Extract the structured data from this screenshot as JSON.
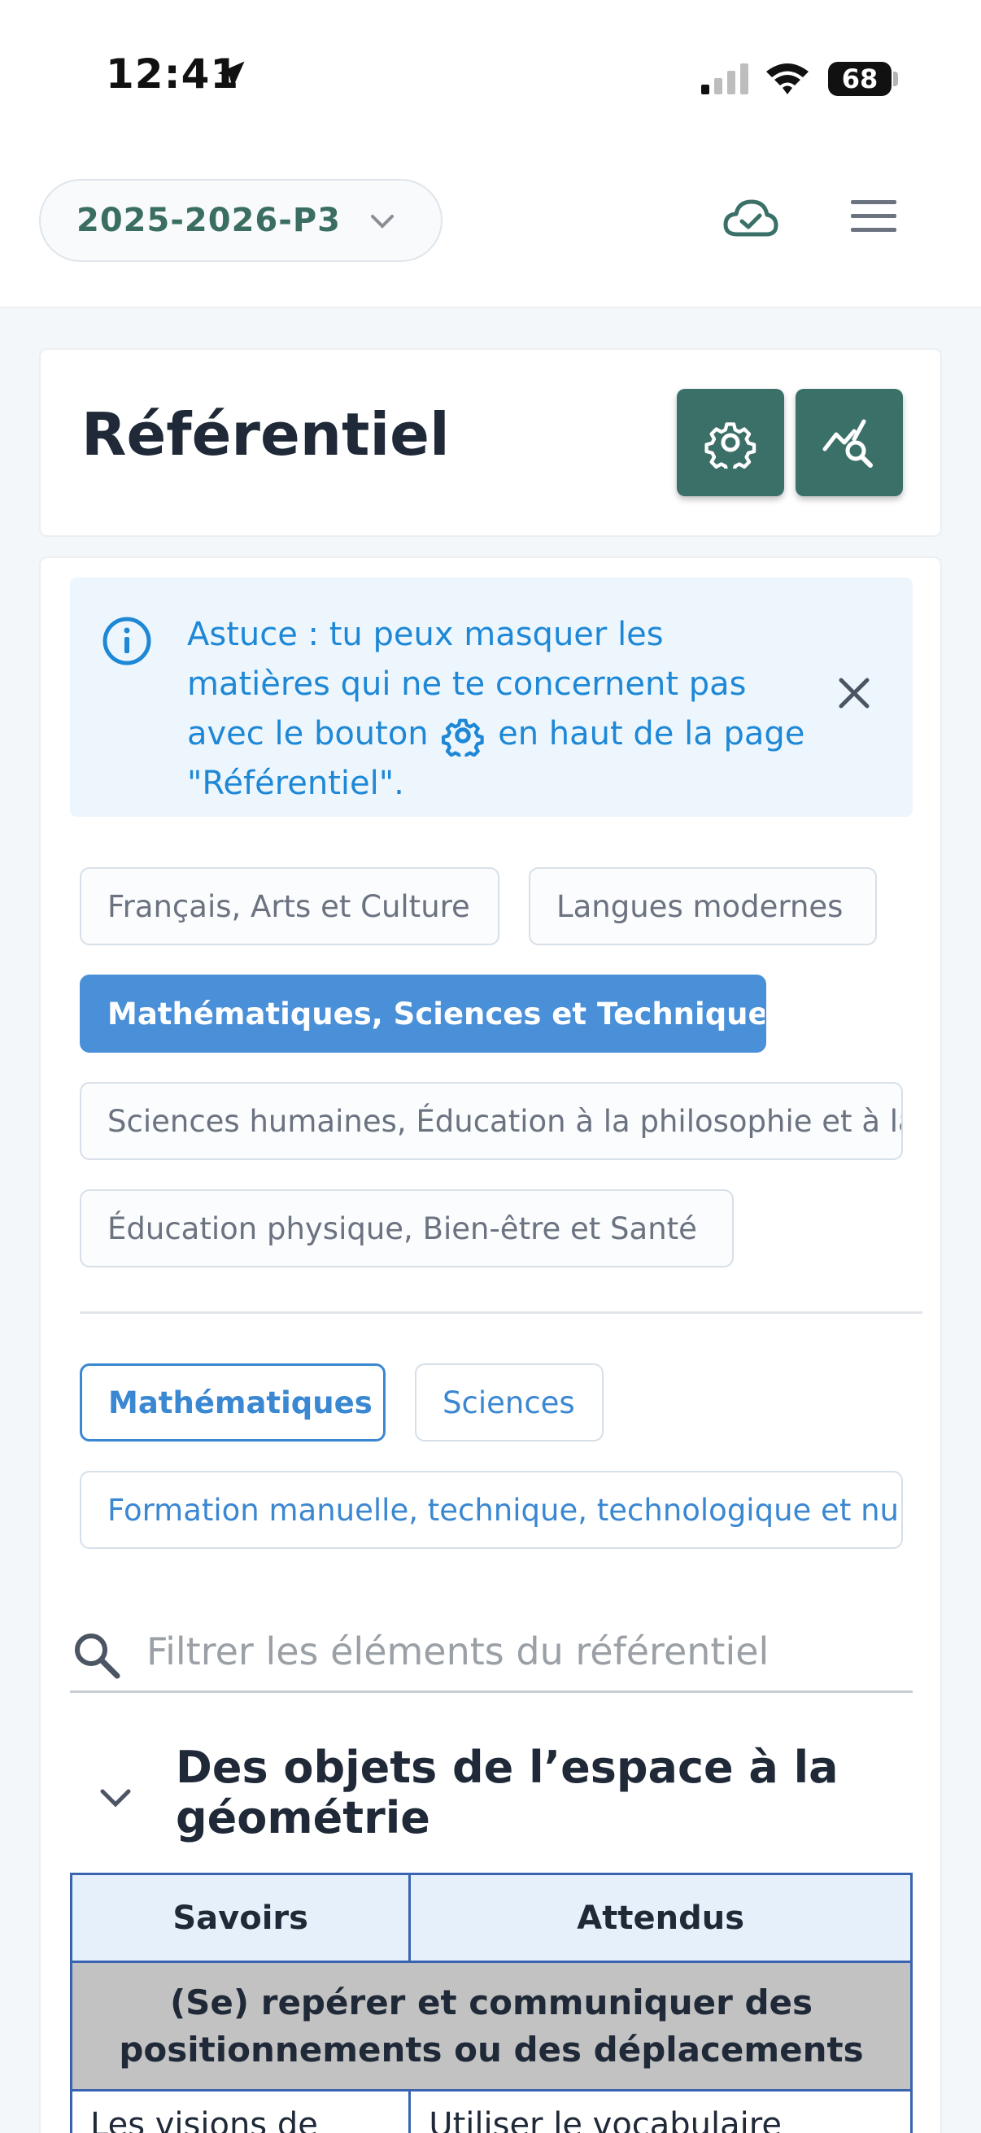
{
  "status_bar": {
    "time": "12:41",
    "battery": "68"
  },
  "top_bar": {
    "year_selector": "2025-2026-P3"
  },
  "title_card": {
    "title": "Référentiel"
  },
  "tip": {
    "text_before_icon": "Astuce : tu peux masquer les matières qui ne te concernent pas avec le bouton",
    "text_after_icon": "en haut de la page \"Référentiel\"."
  },
  "domains": [
    "Français, Arts et Culture",
    "Langues modernes",
    "Mathématiques, Sciences et Techniques",
    "Sciences humaines, Éducation à la philosophie et à la citoyenneté",
    "Éducation physique, Bien-être et Santé"
  ],
  "subjects": [
    "Mathématiques",
    "Sciences",
    "Formation manuelle, technique, technologique et numérique"
  ],
  "search": {
    "placeholder": "Filtrer les éléments du référentiel"
  },
  "section": {
    "title": "Des objets de l’espace à la géométrie",
    "table": {
      "headers": [
        "Savoirs",
        "Attendus"
      ],
      "group": "(Se) repérer et communiquer des positionnements ou des déplacements",
      "first_row": [
        "Les visions de",
        "Utiliser le vocabulaire"
      ]
    }
  },
  "colors": {
    "accent_green": "#3b7068",
    "accent_blue": "#4a90d9",
    "tip_blue": "#1e88d6",
    "table_border": "#3a64b0"
  }
}
